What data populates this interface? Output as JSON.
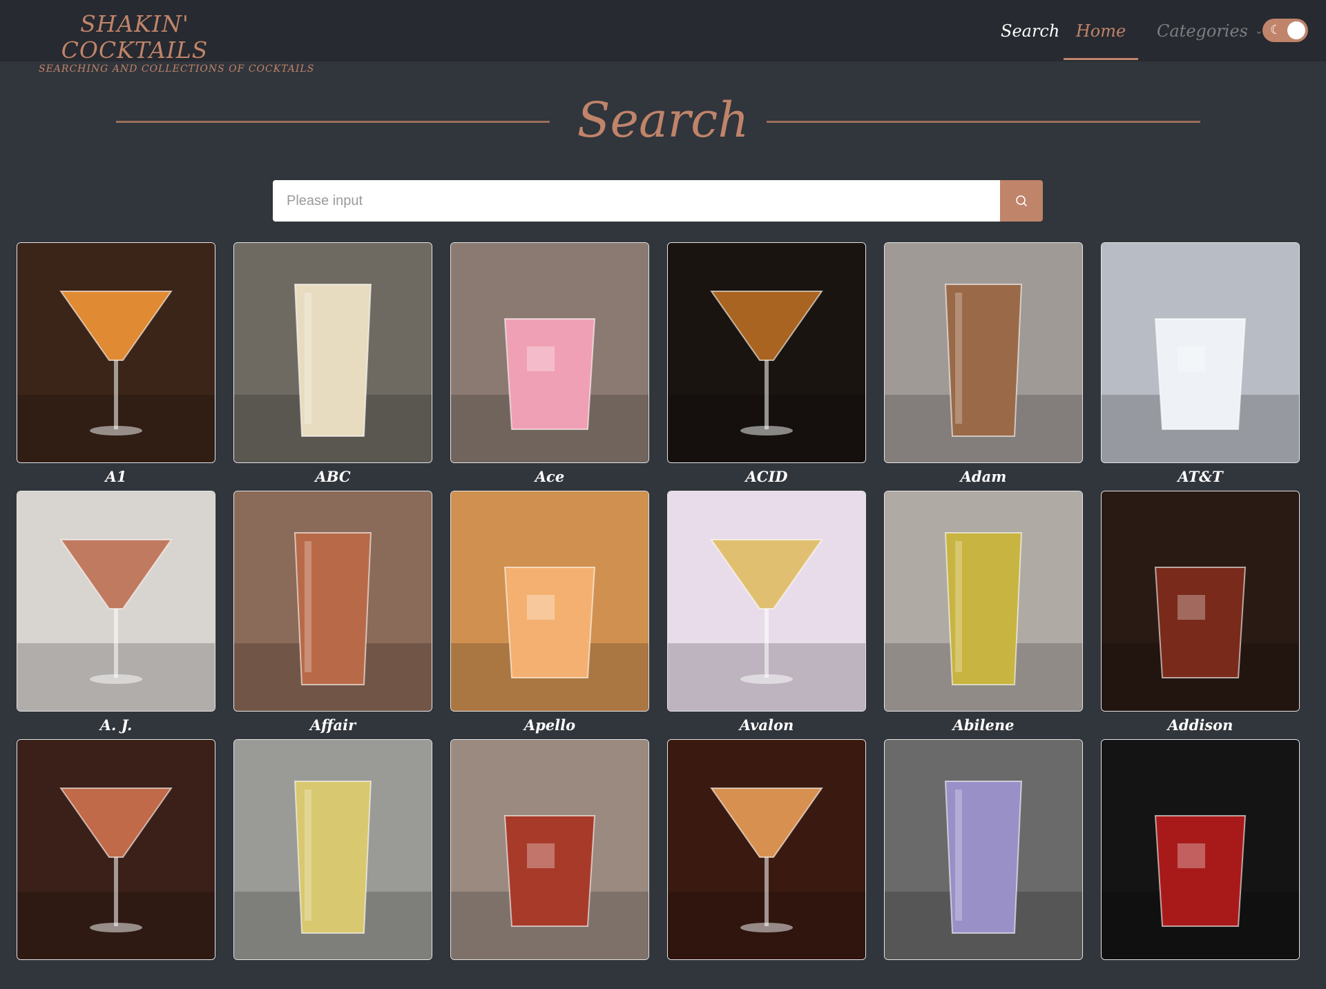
{
  "brand": {
    "title": "SHAKIN' COCKTAILS",
    "subtitle": "SEARCHING AND COLLECTIONS OF COCKTAILS"
  },
  "nav": {
    "search": "Search",
    "home": "Home",
    "categories": "Categories"
  },
  "theme_toggle": {
    "icon": "moon-icon",
    "state": "on"
  },
  "section": {
    "title": "Search"
  },
  "search": {
    "placeholder": "Please input",
    "value": ""
  },
  "colors": {
    "accent": "#c0846a",
    "background": "#31353c",
    "topbar": "#272a30"
  },
  "cocktails": [
    {
      "name": "A1",
      "palette": [
        "#3b2418",
        "#e08a34"
      ]
    },
    {
      "name": "ABC",
      "palette": [
        "#6e6a62",
        "#e8dcc0"
      ]
    },
    {
      "name": "Ace",
      "palette": [
        "#8a7a72",
        "#f0a0b4"
      ]
    },
    {
      "name": "ACID",
      "palette": [
        "#1a1410",
        "#a86420"
      ]
    },
    {
      "name": "Adam",
      "palette": [
        "#a09a96",
        "#9a6a48"
      ]
    },
    {
      "name": "AT&T",
      "palette": [
        "#b8bcc4",
        "#eef2f6"
      ]
    },
    {
      "name": "A. J.",
      "palette": [
        "#d8d4d0",
        "#c07a60"
      ]
    },
    {
      "name": "Affair",
      "palette": [
        "#8a6a58",
        "#b86a48"
      ]
    },
    {
      "name": "Apello",
      "palette": [
        "#d09050",
        "#f4b070"
      ]
    },
    {
      "name": "Avalon",
      "palette": [
        "#e8dcea",
        "#e0c070"
      ]
    },
    {
      "name": "Abilene",
      "palette": [
        "#b0aaa4",
        "#c8b440"
      ]
    },
    {
      "name": "Addison",
      "palette": [
        "#2a1a14",
        "#7a2a1a"
      ]
    },
    {
      "name": "",
      "palette": [
        "#3a2018",
        "#c06a4a"
      ]
    },
    {
      "name": "",
      "palette": [
        "#9a9a96",
        "#d8c870"
      ]
    },
    {
      "name": "",
      "palette": [
        "#9a8a80",
        "#a83a2a"
      ]
    },
    {
      "name": "",
      "palette": [
        "#3a1a10",
        "#d89050"
      ]
    },
    {
      "name": "",
      "palette": [
        "#6a6a6a",
        "#9a90c8"
      ]
    },
    {
      "name": "",
      "palette": [
        "#141414",
        "#a81a1a"
      ]
    }
  ]
}
